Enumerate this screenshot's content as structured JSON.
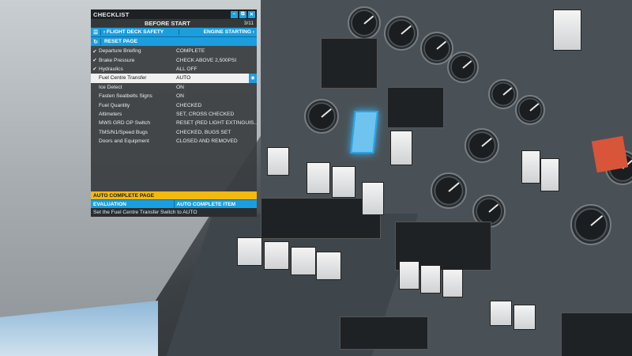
{
  "checklist": {
    "window_title": "CHECKLIST",
    "window_buttons": [
      "–",
      "⧉",
      "✕"
    ],
    "page_title": "BEFORE START",
    "page_count": "3/11",
    "nav": {
      "prev_label": "FLIGHT DECK SAFETY",
      "next_label": "ENGINE STARTING"
    },
    "reset_label": "RESET PAGE",
    "items": [
      {
        "label": "Departure Briefing",
        "value": "COMPLETE",
        "checked": true
      },
      {
        "label": "Brake Pressure",
        "value": "CHECK ABOVE 2,500PSI",
        "checked": true
      },
      {
        "label": "Hydraulics",
        "value": "ALL OFF",
        "checked": true
      },
      {
        "label": "Fuel Centre Transfer",
        "value": "AUTO",
        "checked": false
      },
      {
        "label": "Ice Detect",
        "value": "ON",
        "checked": false
      },
      {
        "label": "Fasten Seatbelts Signs",
        "value": "ON",
        "checked": false
      },
      {
        "label": "Fuel Quantity",
        "value": "CHECKED",
        "checked": false
      },
      {
        "label": "Altimeters",
        "value": "SET, CROSS CHECKED",
        "checked": false
      },
      {
        "label": "MWS GRD OP Switch",
        "value": "RESET (RED LIGHT EXTINGUIS...",
        "checked": false
      },
      {
        "label": "TMS/N1/Speed Bugs",
        "value": "CHECKED, BUGS SET",
        "checked": false
      },
      {
        "label": "Doors and Equipment",
        "value": "CLOSED AND REMOVED",
        "checked": false
      }
    ],
    "active_index": 3,
    "auto_complete_page": "AUTO COMPLETE PAGE",
    "evaluation_label": "EVALUATION",
    "auto_complete_item": "AUTO COMPLETE ITEM",
    "hint_text": "Set the Fuel Centre Transfer Switch to AUTO"
  },
  "colors": {
    "accent_blue": "#1a9ee0",
    "auto_yellow": "#f2b90f",
    "panel_bg": "#3a3d40"
  }
}
